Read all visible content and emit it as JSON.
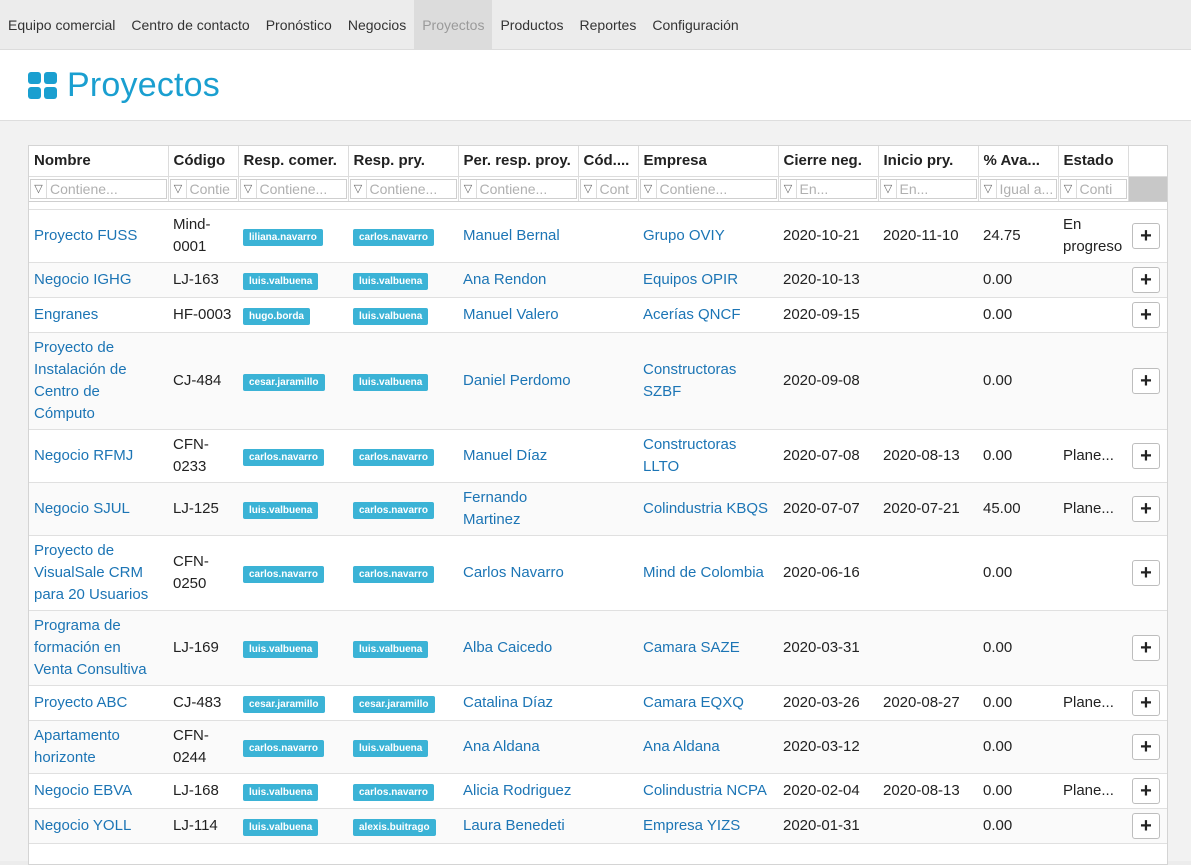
{
  "nav": [
    {
      "label": "Equipo comercial"
    },
    {
      "label": "Centro de contacto"
    },
    {
      "label": "Pronóstico"
    },
    {
      "label": "Negocios"
    },
    {
      "label": "Proyectos",
      "active": true
    },
    {
      "label": "Productos"
    },
    {
      "label": "Reportes"
    },
    {
      "label": "Configuración"
    }
  ],
  "page": {
    "title": "Proyectos",
    "icon": "grid-icon",
    "accent": "#1a9fd0"
  },
  "tag_color": "#3bb3d6",
  "columns": [
    {
      "label": "Nombre",
      "placeholder": "Contiene..."
    },
    {
      "label": "Código",
      "placeholder": "Contie"
    },
    {
      "label": "Resp. comer.",
      "placeholder": "Contiene..."
    },
    {
      "label": "Resp. pry.",
      "placeholder": "Contiene..."
    },
    {
      "label": "Per. resp. proy.",
      "placeholder": "Contiene..."
    },
    {
      "label": "Cód....",
      "placeholder": "Cont"
    },
    {
      "label": "Empresa",
      "placeholder": "Contiene..."
    },
    {
      "label": "Cierre neg.",
      "placeholder": "En..."
    },
    {
      "label": "Inicio pry.",
      "placeholder": "En..."
    },
    {
      "label": "% Ava...",
      "placeholder": "Igual a..."
    },
    {
      "label": "Estado",
      "placeholder": "Conti"
    }
  ],
  "rows": [
    {
      "nombre": "Proyecto FUSS",
      "codigo": "Mind-0001",
      "resp_comer": "liliana.navarro",
      "resp_pry": "carlos.navarro",
      "per_resp": "Manuel Bernal",
      "cod": "",
      "empresa": "Grupo OVIY",
      "cierre": "2020-10-21",
      "inicio": "2020-11-10",
      "avance": "24.75",
      "estado": "En progreso"
    },
    {
      "nombre": "Negocio IGHG",
      "codigo": "LJ-163",
      "resp_comer": "luis.valbuena",
      "resp_pry": "luis.valbuena",
      "per_resp": "Ana Rendon",
      "cod": "",
      "empresa": "Equipos OPIR",
      "cierre": "2020-10-13",
      "inicio": "",
      "avance": "0.00",
      "estado": ""
    },
    {
      "nombre": "Engranes",
      "codigo": "HF-0003",
      "resp_comer": "hugo.borda",
      "resp_pry": "luis.valbuena",
      "per_resp": "Manuel Valero",
      "cod": "",
      "empresa": "Acerías QNCF",
      "cierre": "2020-09-15",
      "inicio": "",
      "avance": "0.00",
      "estado": ""
    },
    {
      "nombre": "Proyecto de Instalación de Centro de Cómputo",
      "codigo": "CJ-484",
      "resp_comer": "cesar.jaramillo",
      "resp_pry": "luis.valbuena",
      "per_resp": "Daniel Perdomo",
      "cod": "",
      "empresa": "Constructoras SZBF",
      "cierre": "2020-09-08",
      "inicio": "",
      "avance": "0.00",
      "estado": ""
    },
    {
      "nombre": "Negocio RFMJ",
      "codigo": "CFN-0233",
      "resp_comer": "carlos.navarro",
      "resp_pry": "carlos.navarro",
      "per_resp": "Manuel Díaz",
      "cod": "",
      "empresa": "Constructoras LLTO",
      "cierre": "2020-07-08",
      "inicio": "2020-08-13",
      "avance": "0.00",
      "estado": "Plane..."
    },
    {
      "nombre": "Negocio SJUL",
      "codigo": "LJ-125",
      "resp_comer": "luis.valbuena",
      "resp_pry": "carlos.navarro",
      "per_resp": "Fernando Martinez",
      "cod": "",
      "empresa": "Colindustria KBQS",
      "cierre": "2020-07-07",
      "inicio": "2020-07-21",
      "avance": "45.00",
      "estado": "Plane..."
    },
    {
      "nombre": "Proyecto de VisualSale CRM para 20 Usuarios",
      "codigo": "CFN-0250",
      "resp_comer": "carlos.navarro",
      "resp_pry": "carlos.navarro",
      "per_resp": "Carlos Navarro",
      "cod": "",
      "empresa": "Mind de Colombia",
      "cierre": "2020-06-16",
      "inicio": "",
      "avance": "0.00",
      "estado": ""
    },
    {
      "nombre": "Programa de formación en Venta Consultiva",
      "codigo": "LJ-169",
      "resp_comer": "luis.valbuena",
      "resp_pry": "luis.valbuena",
      "per_resp": "Alba Caicedo",
      "cod": "",
      "empresa": "Camara SAZE",
      "cierre": "2020-03-31",
      "inicio": "",
      "avance": "0.00",
      "estado": ""
    },
    {
      "nombre": "Proyecto ABC",
      "codigo": "CJ-483",
      "resp_comer": "cesar.jaramillo",
      "resp_pry": "cesar.jaramillo",
      "per_resp": "Catalina Díaz",
      "cod": "",
      "empresa": "Camara EQXQ",
      "cierre": "2020-03-26",
      "inicio": "2020-08-27",
      "avance": "0.00",
      "estado": "Plane..."
    },
    {
      "nombre": "Apartamento horizonte",
      "codigo": "CFN-0244",
      "resp_comer": "carlos.navarro",
      "resp_pry": "luis.valbuena",
      "per_resp": "Ana Aldana",
      "cod": "",
      "empresa": "Ana Aldana",
      "cierre": "2020-03-12",
      "inicio": "",
      "avance": "0.00",
      "estado": ""
    },
    {
      "nombre": "Negocio EBVA",
      "codigo": "LJ-168",
      "resp_comer": "luis.valbuena",
      "resp_pry": "carlos.navarro",
      "per_resp": "Alicia Rodriguez",
      "cod": "",
      "empresa": "Colindustria NCPA",
      "cierre": "2020-02-04",
      "inicio": "2020-08-13",
      "avance": "0.00",
      "estado": "Plane..."
    },
    {
      "nombre": "Negocio YOLL",
      "codigo": "LJ-114",
      "resp_comer": "luis.valbuena",
      "resp_pry": "alexis.buitrago",
      "per_resp": "Laura Benedeti",
      "cod": "",
      "empresa": "Empresa YIZS",
      "cierre": "2020-01-31",
      "inicio": "",
      "avance": "0.00",
      "estado": ""
    }
  ],
  "action_icon": "plus-icon"
}
